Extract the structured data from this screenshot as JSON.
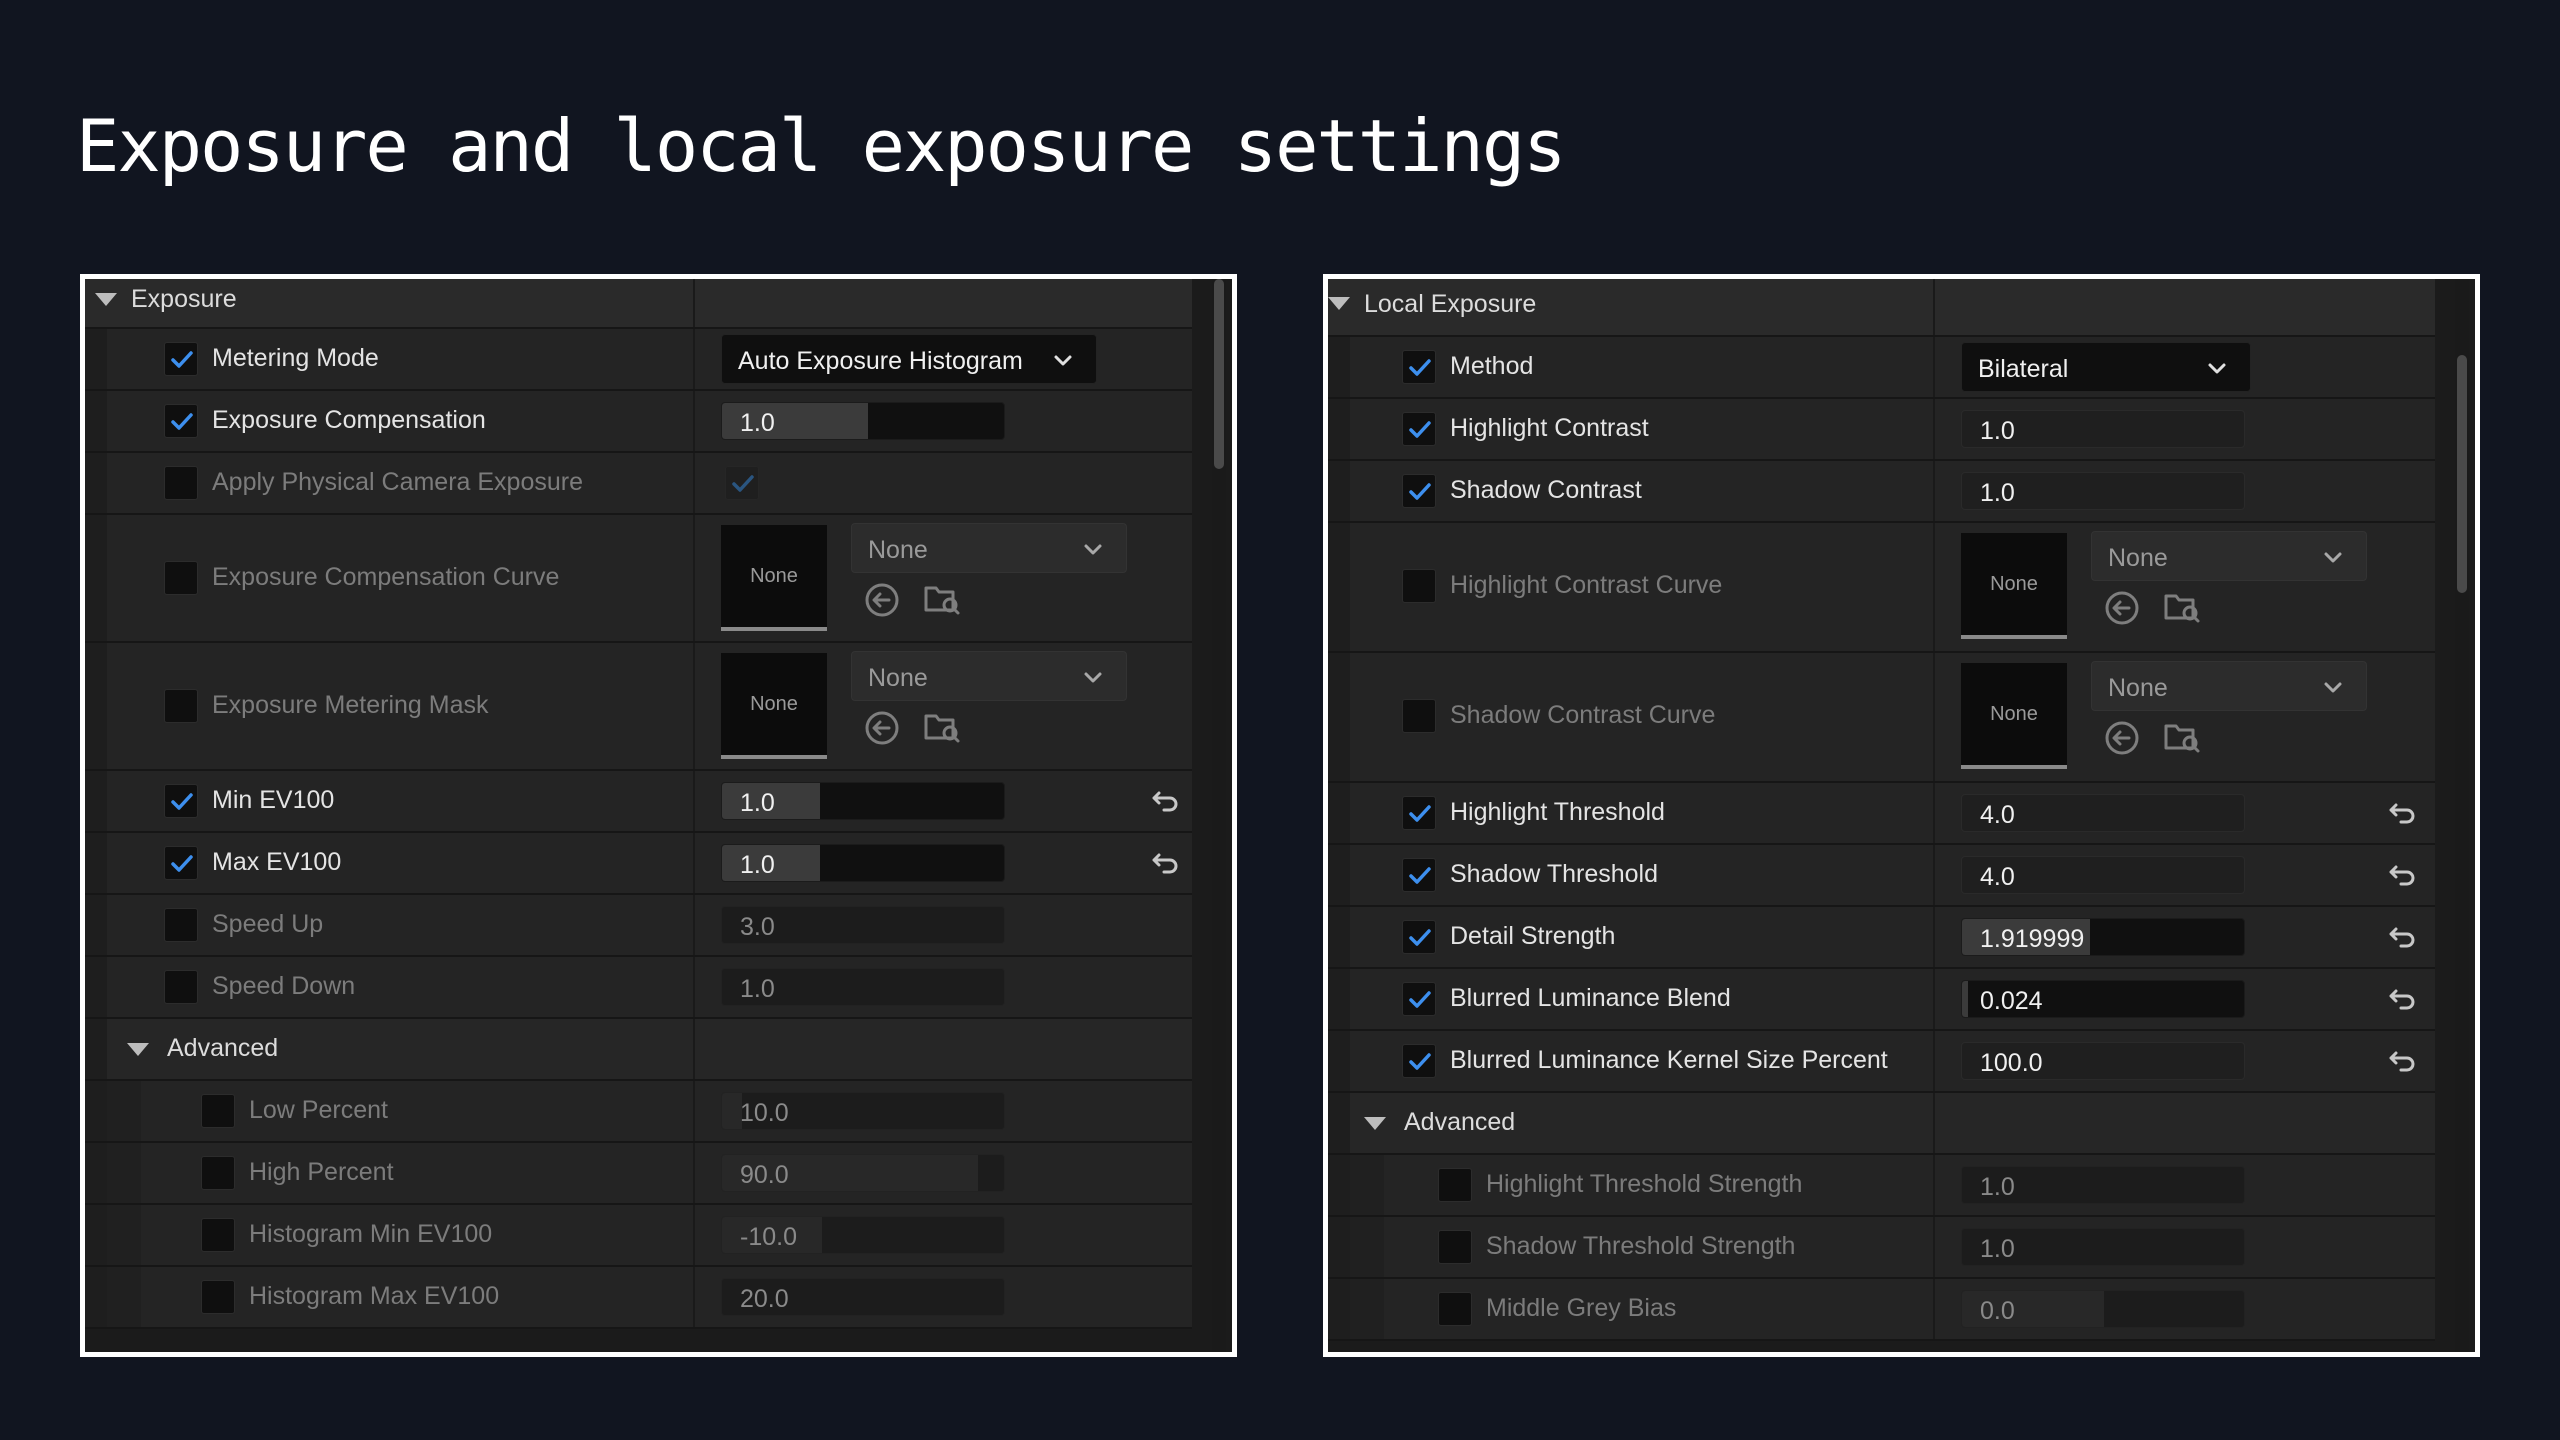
{
  "slide": {
    "title": "Exposure and local exposure settings"
  },
  "exposure": {
    "section_title": "Exposure",
    "metering_mode": {
      "label": "Metering Mode",
      "value": "Auto Exposure Histogram",
      "checked": true
    },
    "exposure_compensation": {
      "label": "Exposure Compensation",
      "value": "1.0",
      "checked": true
    },
    "apply_physical_camera_exposure": {
      "label": "Apply Physical Camera Exposure",
      "checked": false,
      "value_checked": true
    },
    "exposure_compensation_curve": {
      "label": "Exposure Compensation Curve",
      "thumb": "None",
      "value": "None",
      "checked": false
    },
    "exposure_metering_mask": {
      "label": "Exposure Metering Mask",
      "thumb": "None",
      "value": "None",
      "checked": false
    },
    "min_ev100": {
      "label": "Min EV100",
      "value": "1.0",
      "checked": true
    },
    "max_ev100": {
      "label": "Max EV100",
      "value": "1.0",
      "checked": true
    },
    "speed_up": {
      "label": "Speed Up",
      "value": "3.0",
      "checked": false
    },
    "speed_down": {
      "label": "Speed Down",
      "value": "1.0",
      "checked": false
    },
    "advanced": {
      "title": "Advanced",
      "low_percent": {
        "label": "Low Percent",
        "value": "10.0",
        "checked": false
      },
      "high_percent": {
        "label": "High Percent",
        "value": "90.0",
        "checked": false
      },
      "histogram_min_ev100": {
        "label": "Histogram Min EV100",
        "value": "-10.0",
        "checked": false
      },
      "histogram_max_ev100": {
        "label": "Histogram Max EV100",
        "value": "20.0",
        "checked": false
      }
    }
  },
  "local_exposure": {
    "section_title": "Local Exposure",
    "method": {
      "label": "Method",
      "value": "Bilateral",
      "checked": true
    },
    "highlight_contrast": {
      "label": "Highlight Contrast",
      "value": "1.0",
      "checked": true
    },
    "shadow_contrast": {
      "label": "Shadow Contrast",
      "value": "1.0",
      "checked": true
    },
    "highlight_contrast_curve": {
      "label": "Highlight Contrast Curve",
      "thumb": "None",
      "value": "None",
      "checked": false
    },
    "shadow_contrast_curve": {
      "label": "Shadow Contrast Curve",
      "thumb": "None",
      "value": "None",
      "checked": false
    },
    "highlight_threshold": {
      "label": "Highlight Threshold",
      "value": "4.0",
      "checked": true
    },
    "shadow_threshold": {
      "label": "Shadow Threshold",
      "value": "4.0",
      "checked": true
    },
    "detail_strength": {
      "label": "Detail Strength",
      "value": "1.919999",
      "checked": true
    },
    "blurred_luminance_blend": {
      "label": "Blurred Luminance Blend",
      "value": "0.024",
      "checked": true
    },
    "blurred_luminance_kernel_size_percent": {
      "label": "Blurred Luminance Kernel Size Percent",
      "value": "100.0",
      "checked": true
    },
    "advanced": {
      "title": "Advanced",
      "highlight_threshold_strength": {
        "label": "Highlight Threshold Strength",
        "value": "1.0",
        "checked": false
      },
      "shadow_threshold_strength": {
        "label": "Shadow Threshold Strength",
        "value": "1.0",
        "checked": false
      },
      "middle_grey_bias": {
        "label": "Middle Grey Bias",
        "value": "0.0",
        "checked": false
      }
    }
  },
  "icons": {
    "checkmark": "checkmark-icon",
    "chevron": "chevron-down-icon",
    "collapse": "triangle-down-icon",
    "use_selected": "arrow-left-circle-icon",
    "browse": "folder-search-icon",
    "reset": "reset-arrow-icon"
  },
  "colors": {
    "accent": "#3d8fee",
    "background": "#111520",
    "panel": "#242424"
  }
}
